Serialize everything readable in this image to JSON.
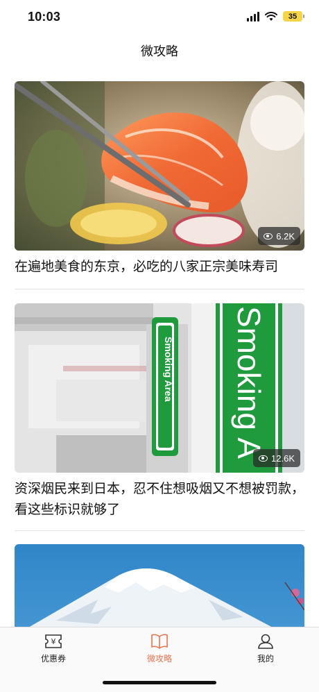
{
  "status_bar": {
    "time": "10:03",
    "battery": "35"
  },
  "header": {
    "title": "微攻略"
  },
  "articles": [
    {
      "title": "在遍地美食的东京，必吃的八家正宗美味寿司",
      "views": "6.2K",
      "image": "salmon-sushi-photo"
    },
    {
      "title": "资深烟民来到日本，忍不住想吸烟又不想被罚款，看这些标识就够了",
      "views": "12.6K",
      "image": "smoking-area-sign-photo"
    },
    {
      "title": "",
      "views": "",
      "image": "mount-fuji-photo"
    }
  ],
  "tabs": [
    {
      "label": "优惠券",
      "icon": "coupon-icon",
      "active": false
    },
    {
      "label": "微攻略",
      "icon": "book-icon",
      "active": true
    },
    {
      "label": "我的",
      "icon": "profile-icon",
      "active": false
    }
  ],
  "colors": {
    "accent": "#e8734f",
    "text": "#111111",
    "divider": "#e2e2e2"
  }
}
